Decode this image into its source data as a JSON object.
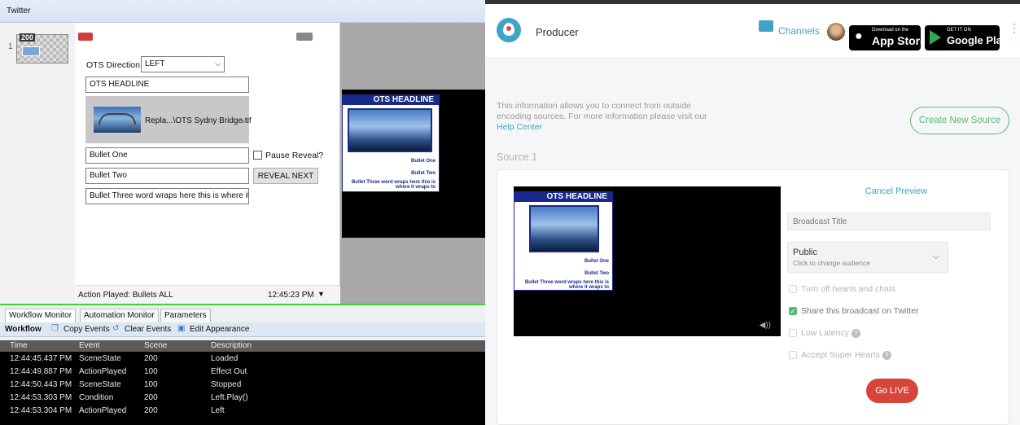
{
  "left_app": {
    "window_title": "Twitter",
    "scene_number": "1",
    "thumb_label": "200",
    "ots_direction_label": "OTS Direction",
    "ots_direction_value": "LEFT",
    "headline_value": "OTS HEADLINE",
    "image_file": "Repla...\\OTS Sydny Bridge.tif",
    "bullet_one": "Bullet One",
    "bullet_two": "Bullet Two",
    "bullet_three": "Bullet Three word wraps here this is where it v",
    "pause_reveal_label": "Pause Reveal?",
    "reveal_next_label": "REVEAL NEXT",
    "action_played": "Action Played: Bullets ALL",
    "action_time": "12:45:23 PM",
    "preview": {
      "headline": "OTS HEADLINE",
      "bullet_one": "Bullet One",
      "bullet_two": "Bullet Two",
      "bullet_three": "Bullet Three word wraps here this is where it wraps to"
    },
    "tabs": [
      "Workflow Monitor",
      "Automation Monitor",
      "Parameters"
    ],
    "workflow_toolbar": {
      "title": "Workflow",
      "copy": "Copy Events",
      "clear": "Clear Events",
      "edit": "Edit Appearance"
    },
    "columns": [
      "Time",
      "Event",
      "Scene",
      "Description"
    ],
    "rows": [
      [
        "12:44:45.437 PM",
        "SceneState",
        "200",
        "Loaded"
      ],
      [
        "12:44:49.887 PM",
        "ActionPlayed",
        "100",
        "Effect Out"
      ],
      [
        "12:44:50.443 PM",
        "SceneState",
        "100",
        "Stopped"
      ],
      [
        "12:44:53.303 PM",
        "Condition",
        "200",
        "Left.Play()"
      ],
      [
        "12:44:53.304 PM",
        "ActionPlayed",
        "200",
        "Left"
      ]
    ]
  },
  "right_app": {
    "brand": "Producer",
    "channels_label": "Channels",
    "app_store_small": "Download on the",
    "app_store_big": "App Store",
    "google_small": "GET IT ON",
    "google_big": "Google Play",
    "info_text": "This information allows you to connect from outside encoding sources. For more information please visit our",
    "help_link": "Help Center",
    "create_button": "Create New Source",
    "source_title": "Source 1",
    "cancel_preview": "Cancel Preview",
    "broadcast_title_placeholder": "Broadcast Title",
    "audience_value": "Public",
    "audience_hint": "Click to change audience",
    "options": [
      {
        "label": "Turn off hearts and chats",
        "checked": false,
        "help": false
      },
      {
        "label": "Share this broadcast on Twitter",
        "checked": true,
        "help": false
      },
      {
        "label": "Low Latency",
        "checked": false,
        "help": true
      },
      {
        "label": "Accept Super Hearts",
        "checked": false,
        "help": true
      }
    ],
    "go_live": "Go LIVE",
    "preview": {
      "headline": "OTS HEADLINE",
      "bullet_one": "Bullet One",
      "bullet_two": "Bullet Two",
      "bullet_three": "Bullet Three word wraps here this is where it wraps to"
    },
    "colors": {
      "accent_green": "#5bb974",
      "live_red": "#d9443a",
      "brand_blue": "#40a4c4"
    }
  }
}
